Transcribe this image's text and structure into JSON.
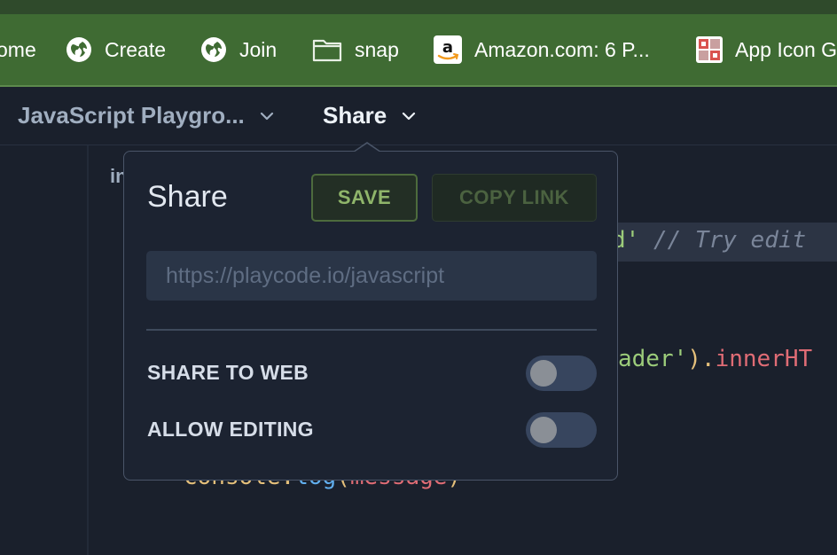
{
  "bookmarks": [
    {
      "label": "ome",
      "icon": "none"
    },
    {
      "label": "Create",
      "icon": "globe-icon"
    },
    {
      "label": "Join",
      "icon": "globe-icon"
    },
    {
      "label": "snap",
      "icon": "folder-icon"
    },
    {
      "label": "Amazon.com: 6 P...",
      "icon": "amazon-icon"
    },
    {
      "label": "App Icon G",
      "icon": "grid-icon"
    }
  ],
  "nav": {
    "project_title": "JavaScript Playgro...",
    "share_menu": "Share"
  },
  "code": {
    "line_fragment_1": "in",
    "string_fragment": "d'",
    "comment_fragment": " // Try edit",
    "selector_fragment": "ader'",
    "paren_fragment": ").",
    "prop_fragment": "innerHT",
    "console_fragment": "console.",
    "log_fragment": "log",
    "open_paren": "(",
    "arg_fragment": "message",
    "close_paren": ")"
  },
  "share_popover": {
    "title": "Share",
    "save_label": "SAVE",
    "copy_link_label": "COPY LINK",
    "url_placeholder": "https://playcode.io/javascript",
    "share_to_web_label": "SHARE TO WEB",
    "share_to_web_on": false,
    "allow_editing_label": "ALLOW EDITING",
    "allow_editing_on": false
  },
  "colors": {
    "bookmark_bar": "#3f6b33",
    "editor_bg": "#1a202c",
    "accent_green": "#8fb56a",
    "string_green": "#9ccc7a",
    "keyword_red": "#e06c75",
    "yellow": "#e5c07b"
  }
}
